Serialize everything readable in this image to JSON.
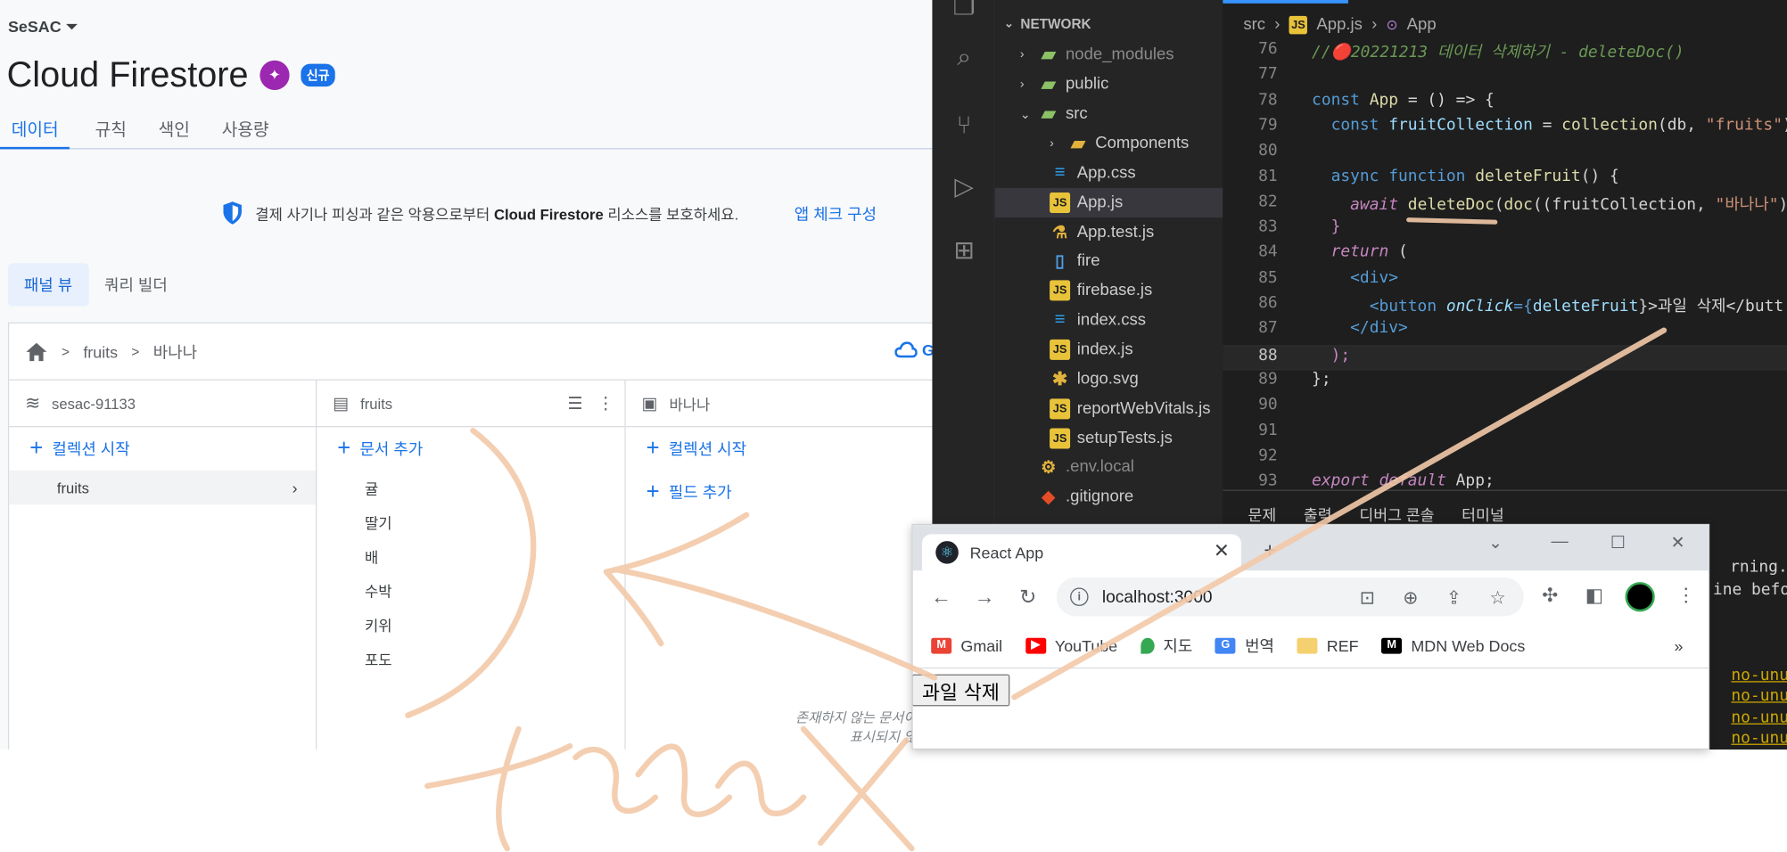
{
  "firestore": {
    "project": "SeSAC",
    "title": "Cloud Firestore",
    "new_badge": "신규",
    "tabs": [
      "데이터",
      "규칙",
      "색인",
      "사용량"
    ],
    "banner_text_1": "결제 사기나 피싱과 같은 악용으로부터",
    "banner_text_bold": "Cloud Firestore",
    "banner_text_2": "리소스를 보호하세요.",
    "banner_link": "앱 체크 구성",
    "views": [
      "패널 뷰",
      "쿼리 빌더"
    ],
    "breadcrumb": [
      "fruits",
      "바나나"
    ],
    "gcloud_label": "G",
    "columns": {
      "root": {
        "title": "sesac-91133",
        "action": "컬렉션 시작",
        "items": [
          "fruits"
        ]
      },
      "collection": {
        "title": "fruits",
        "action": "문서 추가",
        "items": [
          "귤",
          "딸기",
          "배",
          "수박",
          "키위",
          "포도"
        ]
      },
      "document": {
        "title": "바나나",
        "actions": [
          "컬렉션 시작",
          "필드 추가"
        ]
      }
    },
    "empty_note_1": "존재하지 않는 문서이며",
    "empty_note_2": "표시되지 않을"
  },
  "vscode": {
    "explorer_title": "NETWORK",
    "files": [
      {
        "name": "node_modules",
        "type": "folder",
        "dim": true
      },
      {
        "name": "public",
        "type": "folder"
      },
      {
        "name": "src",
        "type": "folder-open"
      },
      {
        "name": "Components",
        "type": "folder-y"
      },
      {
        "name": "App.css",
        "type": "css"
      },
      {
        "name": "App.js",
        "type": "js"
      },
      {
        "name": "App.test.js",
        "type": "test"
      },
      {
        "name": "fire",
        "type": "file"
      },
      {
        "name": "firebase.js",
        "type": "js"
      },
      {
        "name": "index.css",
        "type": "css"
      },
      {
        "name": "index.js",
        "type": "js"
      },
      {
        "name": "logo.svg",
        "type": "svg"
      },
      {
        "name": "reportWebVitals.js",
        "type": "js"
      },
      {
        "name": "setupTests.js",
        "type": "js"
      },
      {
        "name": ".env.local",
        "type": "env",
        "dim": true
      },
      {
        "name": ".gitignore",
        "type": "git"
      }
    ],
    "breadcrumb": [
      "src",
      "App.js",
      "App"
    ],
    "line_numbers": [
      "76",
      "77",
      "78",
      "79",
      "80",
      "81",
      "82",
      "83",
      "84",
      "85",
      "86",
      "87",
      "88",
      "89",
      "90",
      "91",
      "92",
      "93"
    ],
    "code": {
      "l76": "//🔴20221213 데이터 삭제하기 - deleteDoc()",
      "l78_a": "const",
      "l78_b": "App",
      "l78_c": " = () => {",
      "l79_a": "const",
      "l79_b": "fruitCollection",
      "l79_c": " = ",
      "l79_d": "collection",
      "l79_e": "(db, ",
      "l79_f": "\"fruits\"",
      "l79_g": ");",
      "l81_a": "async function",
      "l81_b": "deleteFruit",
      "l81_c": "() {",
      "l82_a": "await",
      "l82_b": "deleteDoc",
      "l82_c": "doc",
      "l82_d": "(fruitCollection, ",
      "l82_e": "\"바나나\"",
      "l82_f": "));",
      "l83": "}",
      "l84_a": "return",
      "l84_b": " (",
      "l85": "<div>",
      "l86_a": "<button ",
      "l86_b": "onClick",
      "l86_c": "={",
      "l86_d": "deleteFruit",
      "l86_e": "}>과일 삭제</butt",
      "l87": "</div>",
      "l88": ");",
      "l89": "};",
      "l93_a": "export default",
      "l93_b": "App;"
    },
    "panel_tabs": [
      "문제",
      "출력",
      "디버그 콘솔",
      "터미널"
    ],
    "terminal": {
      "warning": "rning.",
      "line_before": "ine before",
      "no_unused": [
        "no-unus",
        "no-unus",
        "no-unus",
        "no-unus"
      ]
    }
  },
  "browser": {
    "tab_title": "React App",
    "url": "localhost:3000",
    "bookmarks": [
      "Gmail",
      "YouTube",
      "지도",
      "번역",
      "REF",
      "MDN Web Docs"
    ],
    "page_button": "과일 삭제"
  }
}
